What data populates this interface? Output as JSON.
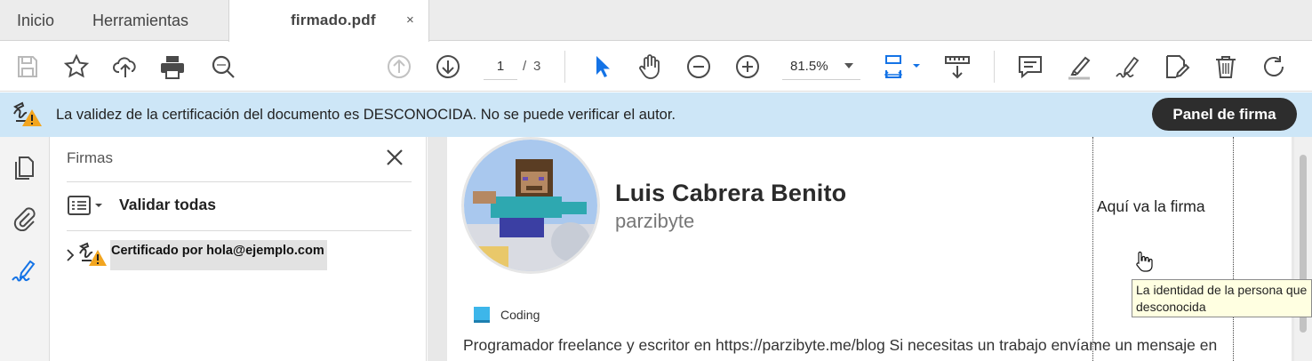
{
  "tabs": {
    "home": "Inicio",
    "tools": "Herramientas",
    "document": "firmado.pdf",
    "close_glyph": "×"
  },
  "toolbar": {
    "icons": [
      "save-icon",
      "bookmark-star-icon",
      "upload-cloud-icon",
      "print-icon",
      "zoom-search-icon",
      "page-up-icon",
      "page-down-icon",
      "select-arrow-icon",
      "hand-icon",
      "zoom-out-icon",
      "zoom-in-icon",
      "fit-page-icon",
      "measure-icon",
      "comment-icon",
      "highlight-icon",
      "sign-icon",
      "edit-icon",
      "delete-icon",
      "rotate-icon"
    ],
    "page_current": "1",
    "page_separator": "/",
    "page_total": "3",
    "zoom": "81.5%"
  },
  "banner": {
    "message": "La validez de la certificación del documento es DESCONOCIDA. No se puede verificar el autor.",
    "button": "Panel de firma",
    "background": "#cde6f7"
  },
  "signatures_panel": {
    "title": "Firmas",
    "validate_all": "Validar todas",
    "certificate": "Certificado por hola@ejemplo.com"
  },
  "document": {
    "name": "Luis Cabrera Benito",
    "username": "parzibyte",
    "tag": "Coding",
    "bio": "Programador freelance y escritor en https://parzibyte.me/blog Si necesitas un trabajo envíame un mensaje en",
    "signature_field": "Aquí va la firma"
  },
  "tooltip": {
    "line1": "La identidad de la persona que",
    "line2": "desconocida"
  },
  "colors": {
    "accent_blue": "#1473e6",
    "warning_orange": "#f2a51f",
    "dark_button": "#2d2d2d"
  }
}
